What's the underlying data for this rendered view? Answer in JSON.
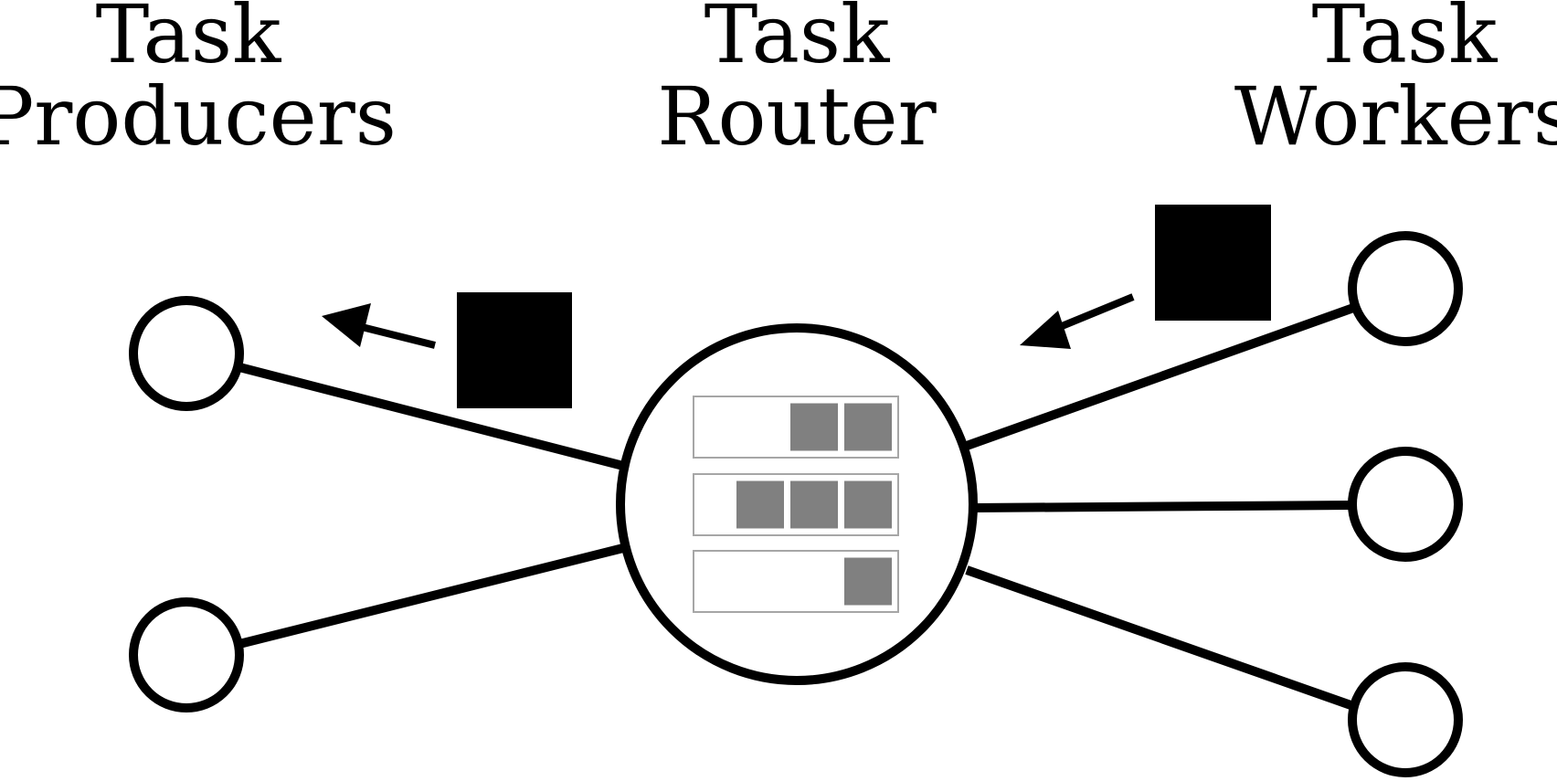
{
  "headings": {
    "producers": {
      "line1": "Task",
      "line2": "Producers"
    },
    "router": {
      "line1": "Task",
      "line2": "Router"
    },
    "workers": {
      "line1": "Task",
      "line2": "Workers"
    }
  },
  "router_queues": [
    {
      "queued_tasks": 2
    },
    {
      "queued_tasks": 3
    },
    {
      "queued_tasks": 1
    }
  ],
  "colors": {
    "stroke": "#000000",
    "queued_task": "#808080",
    "queue_border": "#a6a6a6",
    "moving_task": "#000000"
  }
}
